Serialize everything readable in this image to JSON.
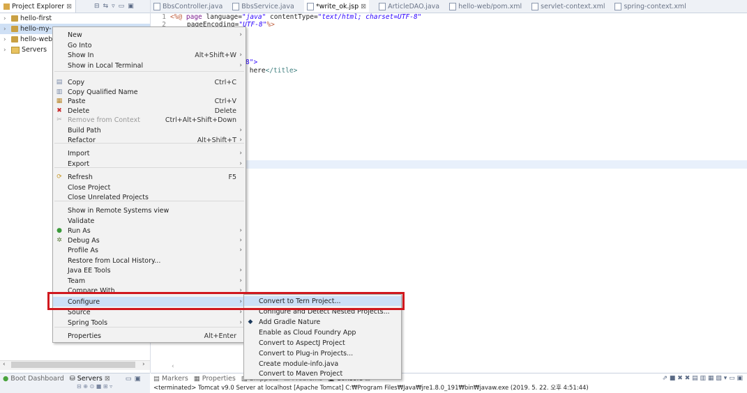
{
  "explorer": {
    "title": "Project Explorer",
    "tab_close": "⊠",
    "items": [
      {
        "label": "hello-first",
        "icon": "project-icon"
      },
      {
        "label": "hello-my-",
        "icon": "project-icon"
      },
      {
        "label": "hello-web",
        "icon": "project-icon"
      },
      {
        "label": "Servers",
        "icon": "folder-icon"
      }
    ]
  },
  "editor": {
    "tabs": [
      {
        "label": "BbsController.java"
      },
      {
        "label": "BbsService.java"
      },
      {
        "label": "*write_ok.jsp",
        "close": "⊠"
      },
      {
        "label": "ArticleDAO.java"
      },
      {
        "label": "hello-web/pom.xml"
      },
      {
        "label": "servlet-context.xml"
      },
      {
        "label": "spring-context.xml"
      }
    ],
    "code": {
      "line1_num": "1",
      "line1_dir": "<%@",
      "line1_kw1": " page ",
      "line1_attr1": "language=",
      "line1_val1": "\"java\"",
      "line1_attr2": " contentType=",
      "line1_val2": "\"text/html; charset=UTF-8\"",
      "line2_num": "2",
      "line2_attr": "pageEncoding=",
      "line2_val": "\"UTF-8\"",
      "line2_end": "%>",
      "frag_a": "8\">",
      "frag_b_text": " here",
      "frag_b_tag": "</title>"
    }
  },
  "context_menu": {
    "items": [
      {
        "label": "New",
        "arrow": "›"
      },
      {
        "label": "Go Into"
      },
      {
        "label": "Show In",
        "accel": "Alt+Shift+W",
        "arrow": "›"
      },
      {
        "label": "Show in Local Terminal",
        "arrow": "›"
      },
      {
        "label": "Copy",
        "accel": "Ctrl+C",
        "icon": "copy-icon"
      },
      {
        "label": "Copy Qualified Name",
        "icon": "copy-qualified-icon"
      },
      {
        "label": "Paste",
        "accel": "Ctrl+V",
        "icon": "paste-icon"
      },
      {
        "label": "Delete",
        "accel": "Delete",
        "icon": "delete-icon"
      },
      {
        "label": "Remove from Context",
        "accel": "Ctrl+Alt+Shift+Down",
        "disabled": true,
        "icon": "remove-context-icon"
      },
      {
        "label": "Build Path",
        "arrow": "›"
      },
      {
        "label": "Refactor",
        "accel": "Alt+Shift+T",
        "arrow": "›"
      },
      {
        "label": "Import",
        "arrow": "›"
      },
      {
        "label": "Export",
        "arrow": "›"
      },
      {
        "label": "Refresh",
        "accel": "F5",
        "icon": "refresh-icon"
      },
      {
        "label": "Close Project"
      },
      {
        "label": "Close Unrelated Projects"
      },
      {
        "label": "Show in Remote Systems view"
      },
      {
        "label": "Validate"
      },
      {
        "label": "Run As",
        "arrow": "›",
        "icon": "run-icon"
      },
      {
        "label": "Debug As",
        "arrow": "›",
        "icon": "debug-icon"
      },
      {
        "label": "Profile As",
        "arrow": "›"
      },
      {
        "label": "Restore from Local History..."
      },
      {
        "label": "Java EE Tools",
        "arrow": "›"
      },
      {
        "label": "Team",
        "arrow": "›"
      },
      {
        "label": "Compare With",
        "arrow": "›"
      },
      {
        "label": "Configure",
        "arrow": "›"
      },
      {
        "label": "Source",
        "arrow": "›"
      },
      {
        "label": "Spring Tools",
        "arrow": "›"
      },
      {
        "label": "Properties",
        "accel": "Alt+Enter"
      }
    ]
  },
  "submenu": {
    "items": [
      {
        "label": "Convert to Tern Project..."
      },
      {
        "label": "Configure and Detect Nested Projects..."
      },
      {
        "label": "Add Gradle Nature",
        "icon": "gradle-icon"
      },
      {
        "label": "Enable as Cloud Foundry App"
      },
      {
        "label": "Convert to AspectJ Project"
      },
      {
        "label": "Convert to Plug-in Projects..."
      },
      {
        "label": "Create module-info.java"
      },
      {
        "label": "Convert to Maven Project"
      }
    ]
  },
  "bottom": {
    "left_tabs": [
      {
        "label": "Boot Dashboard"
      },
      {
        "label": "Servers",
        "close": "⊠"
      }
    ],
    "right_tabs": [
      {
        "label": "Markers"
      },
      {
        "label": "Properties"
      },
      {
        "label": "Snippets"
      },
      {
        "label": "Problems"
      },
      {
        "label": "Console",
        "close": "⊠"
      }
    ],
    "console_text": "<terminated> Tomcat v9.0 Server at localhost [Apache Tomcat] C:₩Program Files₩Java₩jre1.8.0_191₩bin₩javaw.exe (2019. 5. 22. 오후 4:51:44)"
  },
  "colors": {
    "highlight_border": "#d0181e",
    "selection": "#cce0f7"
  }
}
